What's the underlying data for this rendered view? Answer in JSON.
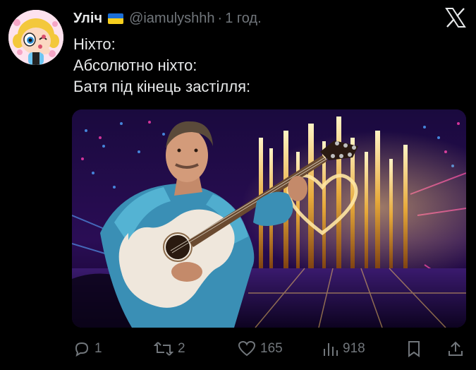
{
  "tweet": {
    "author_name": "Уліч",
    "handle": "@iamulyshhh",
    "separator": "·",
    "time": "1 год.",
    "lines": [
      "Ніхто:",
      "Абсолютно ніхто:",
      "Батя під кінець застілля:"
    ]
  },
  "actions": {
    "replies": "1",
    "reposts": "2",
    "likes": "165",
    "views": "918"
  },
  "icons": {
    "close": "x-logo-icon",
    "reply": "reply-icon",
    "repost": "repost-icon",
    "like": "heart-icon",
    "views": "views-icon",
    "bookmark": "bookmark-icon",
    "share": "share-icon"
  },
  "colors": {
    "background": "#000000",
    "text": "#e7e9ea",
    "muted": "#71767b"
  }
}
